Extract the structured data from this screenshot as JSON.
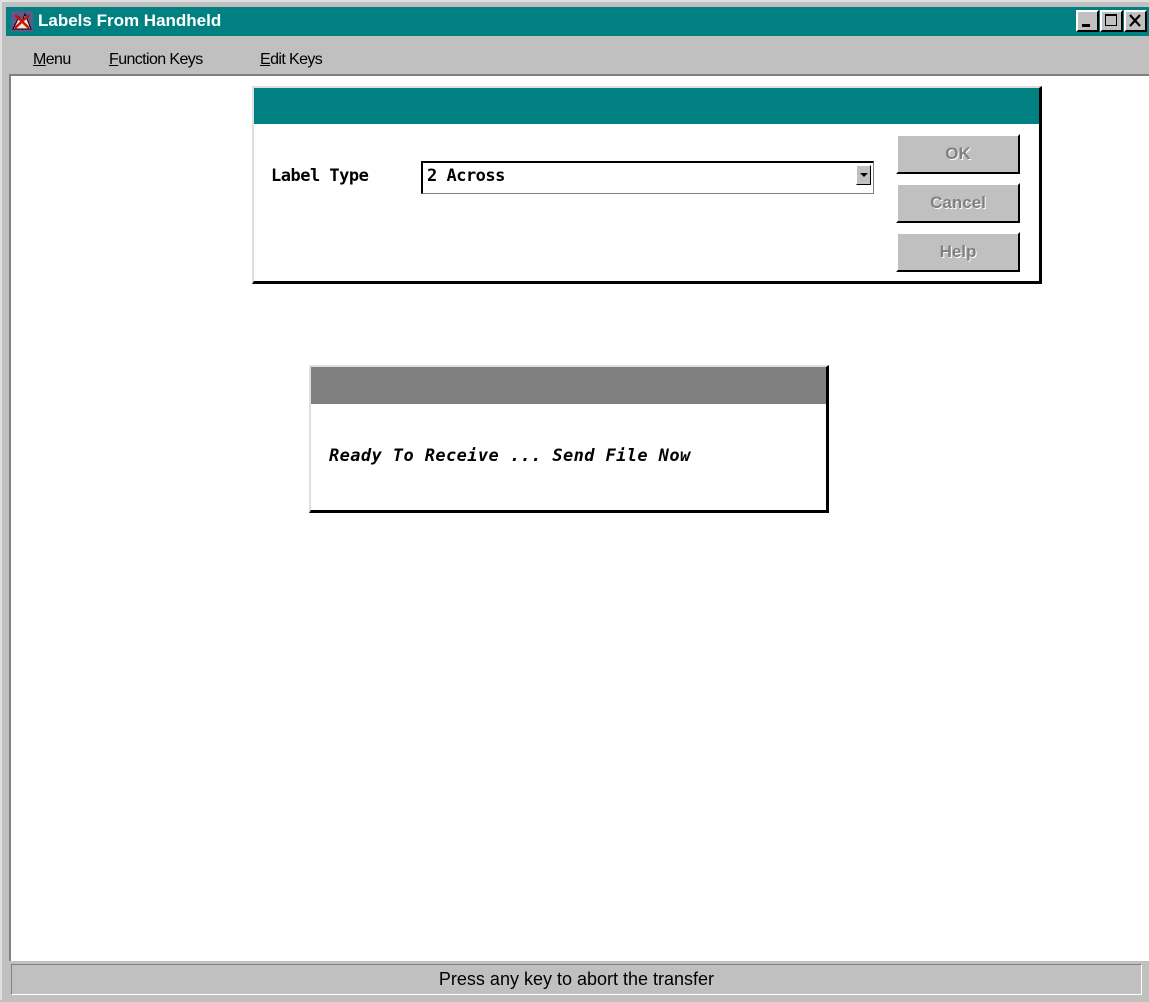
{
  "window": {
    "title": "Labels From Handheld",
    "title_bar_color": "#008080",
    "controls": [
      "minimize-icon",
      "maximize-icon",
      "close-icon"
    ]
  },
  "menubar": {
    "items": [
      {
        "label": "Menu"
      },
      {
        "label": "Function Keys"
      },
      {
        "label": "Edit Keys"
      }
    ]
  },
  "label_dialog": {
    "caption": "",
    "caption_color": "#008080",
    "label_type_label": "Label Type",
    "label_type_value": "2 Across",
    "ok_label": "OK",
    "cancel_label": "Cancel",
    "help_label": "Help"
  },
  "transfer_dialog": {
    "caption": "",
    "caption_color": "#808080",
    "message": "Ready To Receive ... Send File Now"
  },
  "statusbar": {
    "text": "Press any key to abort the transfer"
  }
}
